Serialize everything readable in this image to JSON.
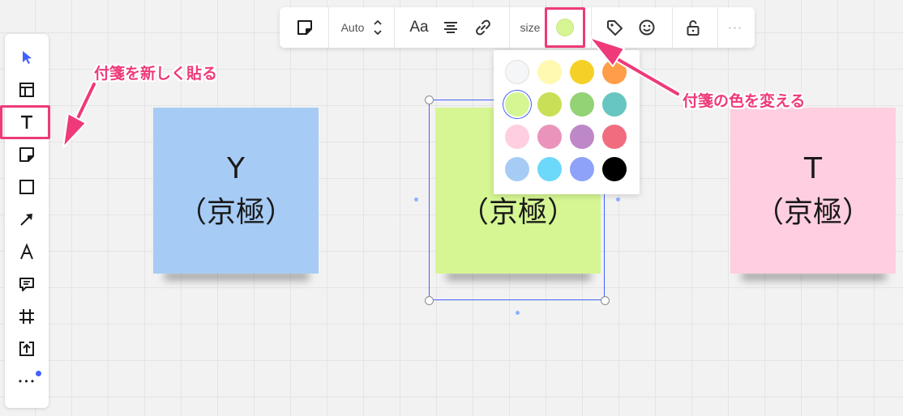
{
  "top_toolbar": {
    "auto_label": "Auto",
    "font_label": "Aa",
    "size_label": "size",
    "more_label": "···",
    "current_color": "#d5f692"
  },
  "left_toolbar": {
    "more_label": "•••"
  },
  "palette": {
    "selected": "#d5f692",
    "colors": [
      [
        "#f5f6f8",
        "#fff9b1",
        "#f5d128",
        "#ff9d48"
      ],
      [
        "#d5f692",
        "#c9df56",
        "#93d275",
        "#67c6c0"
      ],
      [
        "#ffcee0",
        "#ea94bb",
        "#be88c7",
        "#f16c7f"
      ],
      [
        "#a6ccf5",
        "#6cd8fa",
        "#8fa2fa",
        "#000000"
      ]
    ]
  },
  "notes": [
    {
      "line1": "Y",
      "line2": "（京極）",
      "color": "#a6ccf5"
    },
    {
      "line1": "",
      "line2": "（京極）",
      "color": "#d5f692"
    },
    {
      "line1": "T",
      "line2": "（京極）",
      "color": "#ffcee0"
    }
  ],
  "annotations": {
    "sticky_add": "付箋を新しく貼る",
    "sticky_color": "付箋の色を変える"
  }
}
